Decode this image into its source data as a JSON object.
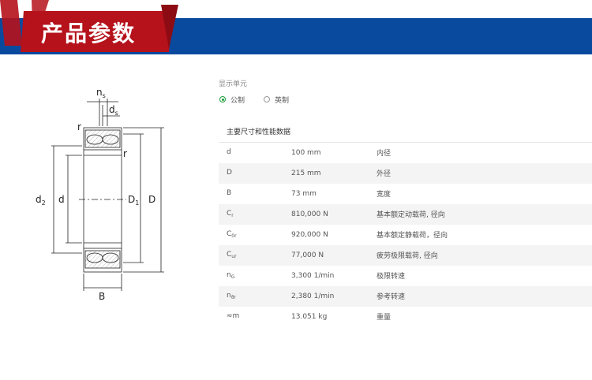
{
  "banner": {
    "title": "产品参数"
  },
  "diagram": {
    "labels": {
      "ns": "n",
      "ns_sub": "s",
      "ds": "d",
      "ds_sub": "s",
      "r": "r",
      "d2": "d",
      "d2_sub": "2",
      "d": "d",
      "D1": "D",
      "D1_sub": "1",
      "D": "D",
      "B": "B"
    }
  },
  "units": {
    "label": "显示单元",
    "options": [
      {
        "label": "公制",
        "selected": true
      },
      {
        "label": "英制",
        "selected": false
      }
    ]
  },
  "section_title": "主要尺寸和性能数据",
  "params": [
    {
      "sym": "d",
      "sub": "",
      "value": "100 mm",
      "desc": "内径"
    },
    {
      "sym": "D",
      "sub": "",
      "value": "215 mm",
      "desc": "外径"
    },
    {
      "sym": "B",
      "sub": "",
      "value": "73 mm",
      "desc": "宽度"
    },
    {
      "sym": "C",
      "sub": "r",
      "value": "810,000 N",
      "desc": "基本额定动载荷, 径向"
    },
    {
      "sym": "C",
      "sub": "0r",
      "value": "920,000 N",
      "desc": "基本额定静载荷，径向"
    },
    {
      "sym": "C",
      "sub": "ur",
      "value": "77,000 N",
      "desc": "疲劳极限载荷, 径向"
    },
    {
      "sym": "n",
      "sub": "G",
      "value": "3,300 1/min",
      "desc": "极限转速"
    },
    {
      "sym": "n",
      "sub": "ϑr",
      "value": "2,380 1/min",
      "desc": "参考转速"
    },
    {
      "sym": "≈m",
      "sub": "",
      "value": "13.051 kg",
      "desc": "重量"
    }
  ],
  "colors": {
    "banner_blue": "#0a4a9e",
    "banner_red": "#b5121b",
    "accent_green": "#1a9e3a"
  }
}
